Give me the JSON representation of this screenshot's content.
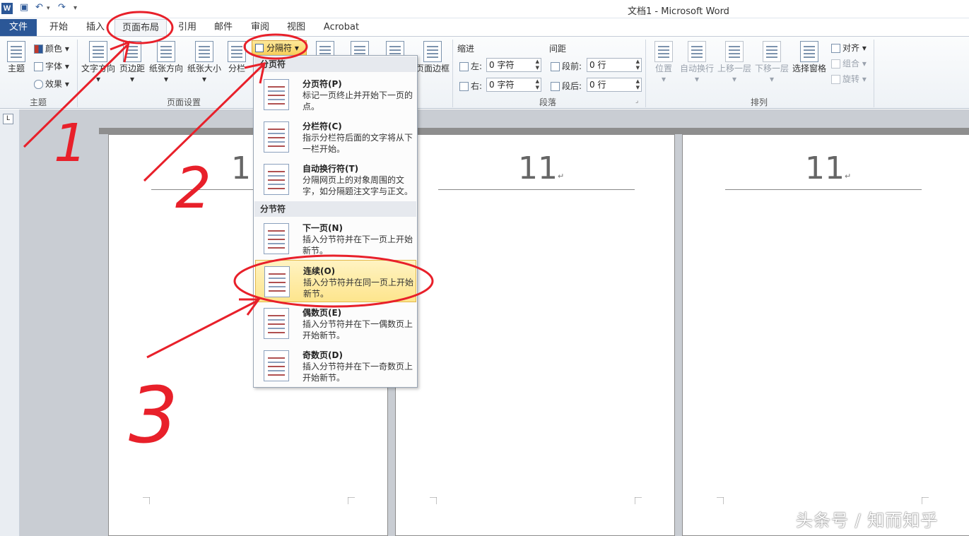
{
  "window": {
    "title": "文档1 - Microsoft Word",
    "app_icon": "W"
  },
  "qat": {
    "save_icon": "save-icon",
    "undo_icon": "undo-icon",
    "redo_icon": "redo-icon"
  },
  "tabs": {
    "file": "文件",
    "items": [
      "开始",
      "插入",
      "页面布局",
      "引用",
      "邮件",
      "审阅",
      "视图",
      "Acrobat"
    ],
    "active": "页面布局"
  },
  "ribbon": {
    "theme": {
      "main": "主题",
      "colors": "颜色",
      "fonts": "字体",
      "effects": "效果",
      "group": "主题"
    },
    "page_setup": {
      "text_dir": "文字方向",
      "margins": "页边距",
      "orientation": "纸张方向",
      "size": "纸张大小",
      "columns": "分栏",
      "breaks": "分隔符",
      "group": "页面设置"
    },
    "page_border": "页面边框",
    "paragraph": {
      "indent": "缩进",
      "spacing": "间距",
      "left_label": "左:",
      "left_value": "0 字符",
      "right_label": "右:",
      "right_value": "0 字符",
      "before_label": "段前:",
      "before_value": "0 行",
      "after_label": "段后:",
      "after_value": "0 行",
      "group": "段落"
    },
    "arrange": {
      "position": "位置",
      "wrap": "自动换行",
      "bring_forward": "上移一层",
      "send_backward": "下移一层",
      "selection_pane": "选择窗格",
      "align": "对齐",
      "group_btn": "组合",
      "rotate": "旋转",
      "group": "排列"
    }
  },
  "menu": {
    "page_breaks_header": "分页符",
    "section_breaks_header": "分节符",
    "items": [
      {
        "title": "分页符(P)",
        "desc": "标记一页终止并开始下一页的点。"
      },
      {
        "title": "分栏符(C)",
        "desc": "指示分栏符后面的文字将从下一栏开始。"
      },
      {
        "title": "自动换行符(T)",
        "desc": "分隔网页上的对象周围的文字，如分隔题注文字与正文。"
      },
      {
        "title": "下一页(N)",
        "desc": "插入分节符并在下一页上开始新节。"
      },
      {
        "title": "连续(O)",
        "desc": "插入分节符并在同一页上开始新节。"
      },
      {
        "title": "偶数页(E)",
        "desc": "插入分节符并在下一偶数页上开始新节。"
      },
      {
        "title": "奇数页(D)",
        "desc": "插入分节符并在下一奇数页上开始新节。"
      }
    ],
    "highlighted": "连续(O)"
  },
  "document": {
    "header_text": "11",
    "pages": 3
  },
  "annotations": {
    "n1": "1",
    "n2": "2",
    "n3": "3"
  },
  "watermark": "头条号 / 知而知乎",
  "colors": {
    "file_tab": "#2b5797",
    "highlight": "#fde58d",
    "annotation": "#e8202a"
  }
}
